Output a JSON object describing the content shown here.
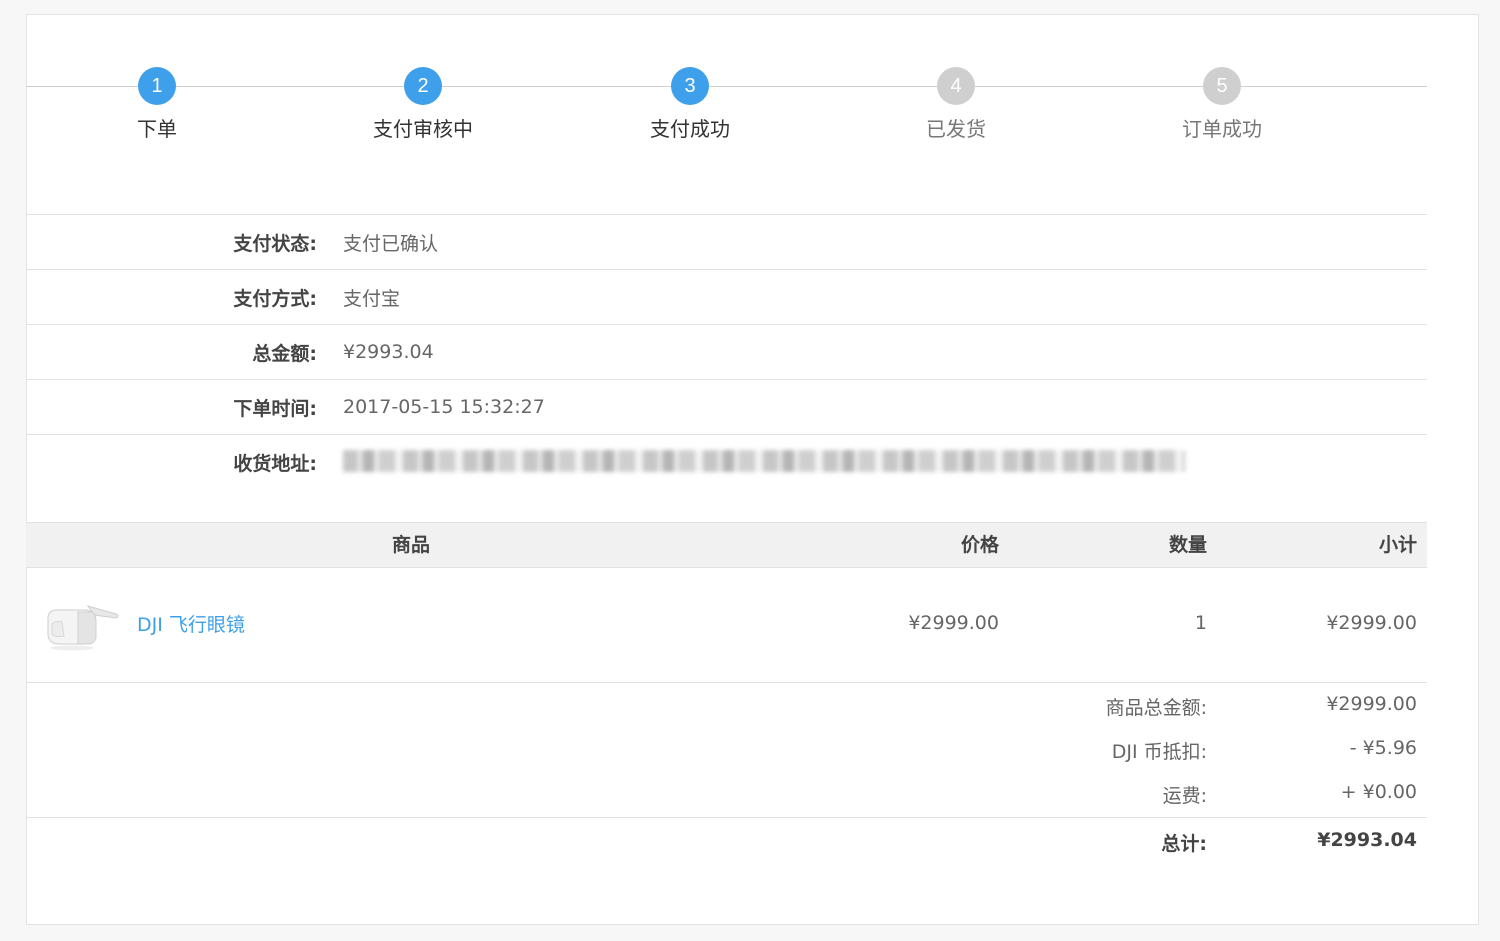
{
  "steps": [
    {
      "number": "1",
      "label": "下单",
      "status": "done"
    },
    {
      "number": "2",
      "label": "支付审核中",
      "status": "done"
    },
    {
      "number": "3",
      "label": "支付成功",
      "status": "done"
    },
    {
      "number": "4",
      "label": "已发货",
      "status": "todo"
    },
    {
      "number": "5",
      "label": "订单成功",
      "status": "todo"
    }
  ],
  "info": {
    "payment_status_label": "支付状态:",
    "payment_status_value": "支付已确认",
    "payment_method_label": "支付方式:",
    "payment_method_value": "支付宝",
    "total_label": "总金额:",
    "total_value": "¥2993.04",
    "order_time_label": "下单时间:",
    "order_time_value": "2017-05-15 15:32:27",
    "address_label": "收货地址:"
  },
  "table": {
    "headers": {
      "product": "商品",
      "price": "价格",
      "quantity": "数量",
      "subtotal": "小计"
    },
    "rows": [
      {
        "name": "DJI 飞行眼镜",
        "price": "¥2999.00",
        "quantity": "1",
        "subtotal": "¥2999.00"
      }
    ]
  },
  "summary": {
    "goods_total_label": "商品总金额:",
    "goods_total_value": "¥2999.00",
    "coin_discount_label": "DJI 币抵扣:",
    "coin_discount_value": "- ¥5.96",
    "shipping_label": "运费:",
    "shipping_value": "+ ¥0.00",
    "grand_total_label": "总计:",
    "grand_total_value": "¥2993.04"
  },
  "colors": {
    "accent": "#3ea0ea",
    "inactive": "#cfcfcf"
  }
}
